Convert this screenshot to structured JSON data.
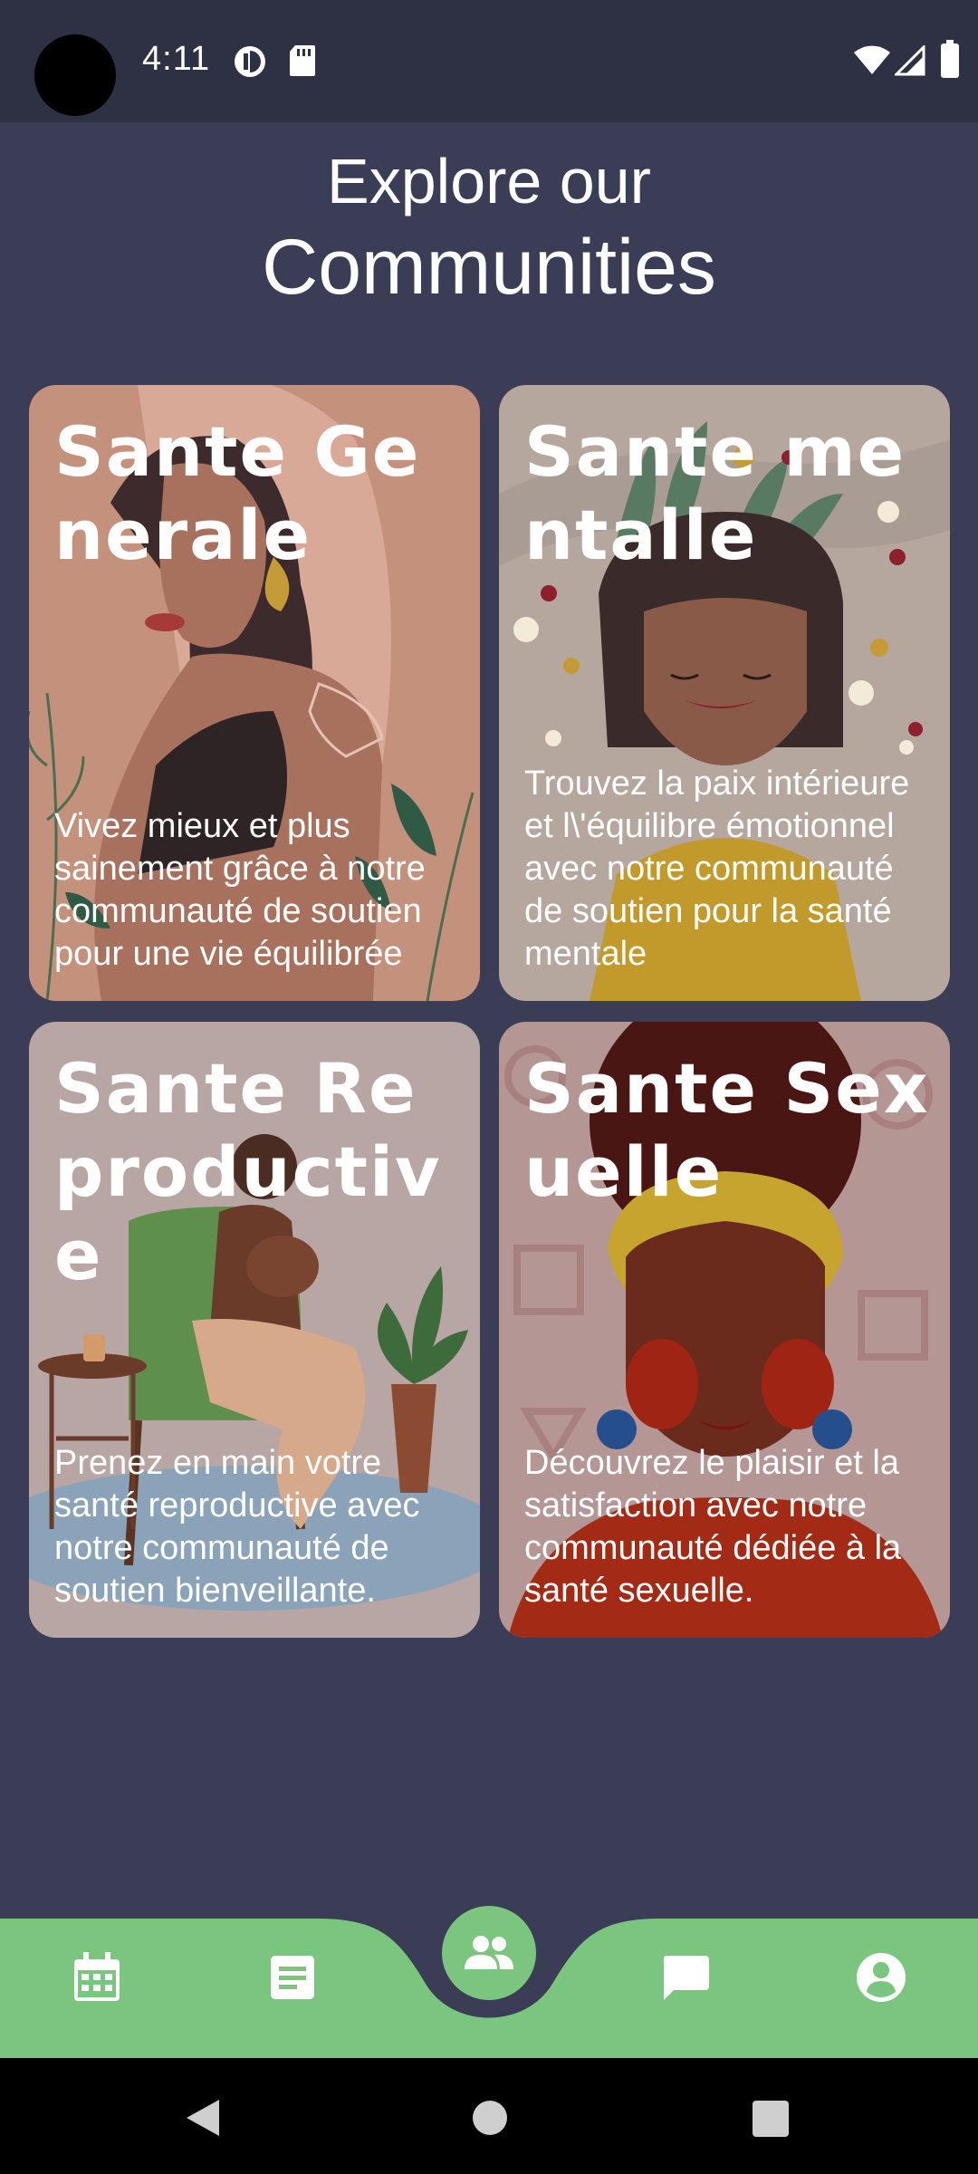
{
  "status_bar": {
    "time": "4:11",
    "icons": [
      "circle-half-icon",
      "sd-card-icon",
      "wifi-icon",
      "signal-icon",
      "battery-icon"
    ]
  },
  "header": {
    "title_line1": "Explore our",
    "title_line2": "Communities"
  },
  "cards": [
    {
      "title": "Sante Generale",
      "description": "Vivez mieux et plus sainement grâce à notre communauté de soutien pour une vie équilibrée"
    },
    {
      "title": "Sante mentalle",
      "description": "Trouvez la paix intérieure et l\\'équilibre émotionnel avec notre communauté de soutien pour la santé mentale"
    },
    {
      "title": "Sante Reproductive",
      "description": "Prenez en main votre santé reproductive avec notre communauté de soutien bienveillante."
    },
    {
      "title": "Sante Sexuelle",
      "description": "Découvrez le plaisir et la satisfaction avec notre communauté dédiée à la santé sexuelle."
    }
  ],
  "bottom_nav": {
    "items": [
      "calendar-icon",
      "article-icon",
      "groups-icon",
      "chat-icon",
      "account-icon"
    ],
    "active": "groups-icon"
  },
  "colors": {
    "background": "#3a3d55",
    "status_bar": "#2e3043",
    "nav_green": "#7bc67e",
    "white": "#ffffff"
  }
}
